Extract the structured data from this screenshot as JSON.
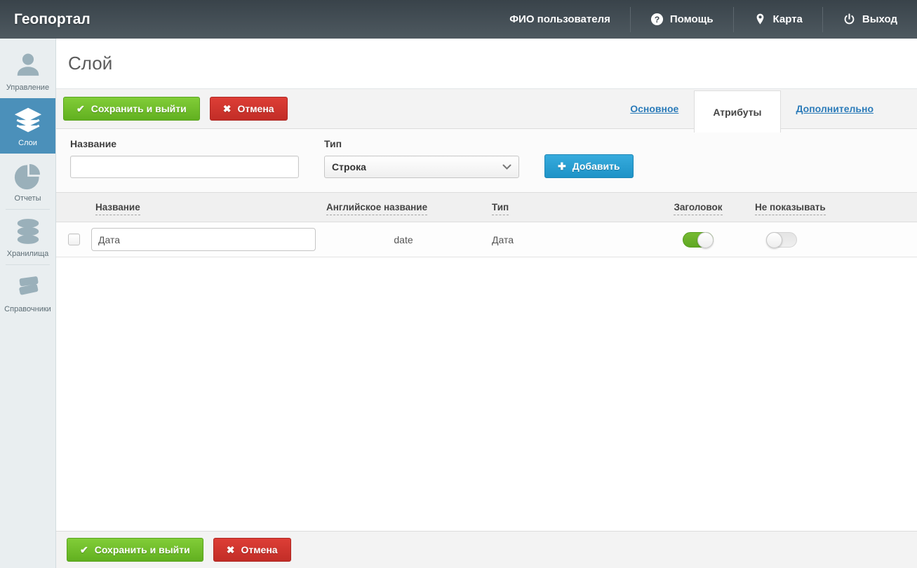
{
  "header": {
    "app_title": "Геопортал",
    "user_name": "ФИО пользователя",
    "help_label": "Помощь",
    "map_label": "Карта",
    "logout_label": "Выход"
  },
  "sidebar": {
    "items": [
      {
        "label": "Управление",
        "icon": "user-icon",
        "active": false
      },
      {
        "label": "Слои",
        "icon": "layers-icon",
        "active": true
      },
      {
        "label": "Отчеты",
        "icon": "pie-chart-icon",
        "active": false
      },
      {
        "label": "Хранилища",
        "icon": "database-icon",
        "active": false
      },
      {
        "label": "Справочники",
        "icon": "books-icon",
        "active": false
      }
    ]
  },
  "page": {
    "title": "Слой"
  },
  "toolbar": {
    "save_label": "Сохранить и выйти",
    "cancel_label": "Отмена"
  },
  "tabs": [
    {
      "label": "Основное",
      "active": false
    },
    {
      "label": "Атрибуты",
      "active": true
    },
    {
      "label": "Дополнительно",
      "active": false
    }
  ],
  "form": {
    "name_label": "Название",
    "name_value": "",
    "type_label": "Тип",
    "type_value": "Строка",
    "add_label": "Добавить"
  },
  "table": {
    "headers": {
      "name": "Название",
      "english_name": "Английское название",
      "type": "Тип",
      "header_col": "Заголовок",
      "hide_col": "Не показывать"
    },
    "rows": [
      {
        "name": "Дата",
        "english_name": "date",
        "type": "Дата",
        "header_toggle": true,
        "hide_toggle": false
      }
    ]
  },
  "footer": {
    "save_label": "Сохранить и выйти",
    "cancel_label": "Отмена"
  },
  "colors": {
    "header_bg": "#414b52",
    "sidebar_active": "#4b90ba",
    "accent_green": "#6cbf2a",
    "accent_red": "#d0342d",
    "accent_blue": "#29a0d4",
    "tab_link": "#2b7bb9",
    "toggle_on": "#68b42c"
  }
}
